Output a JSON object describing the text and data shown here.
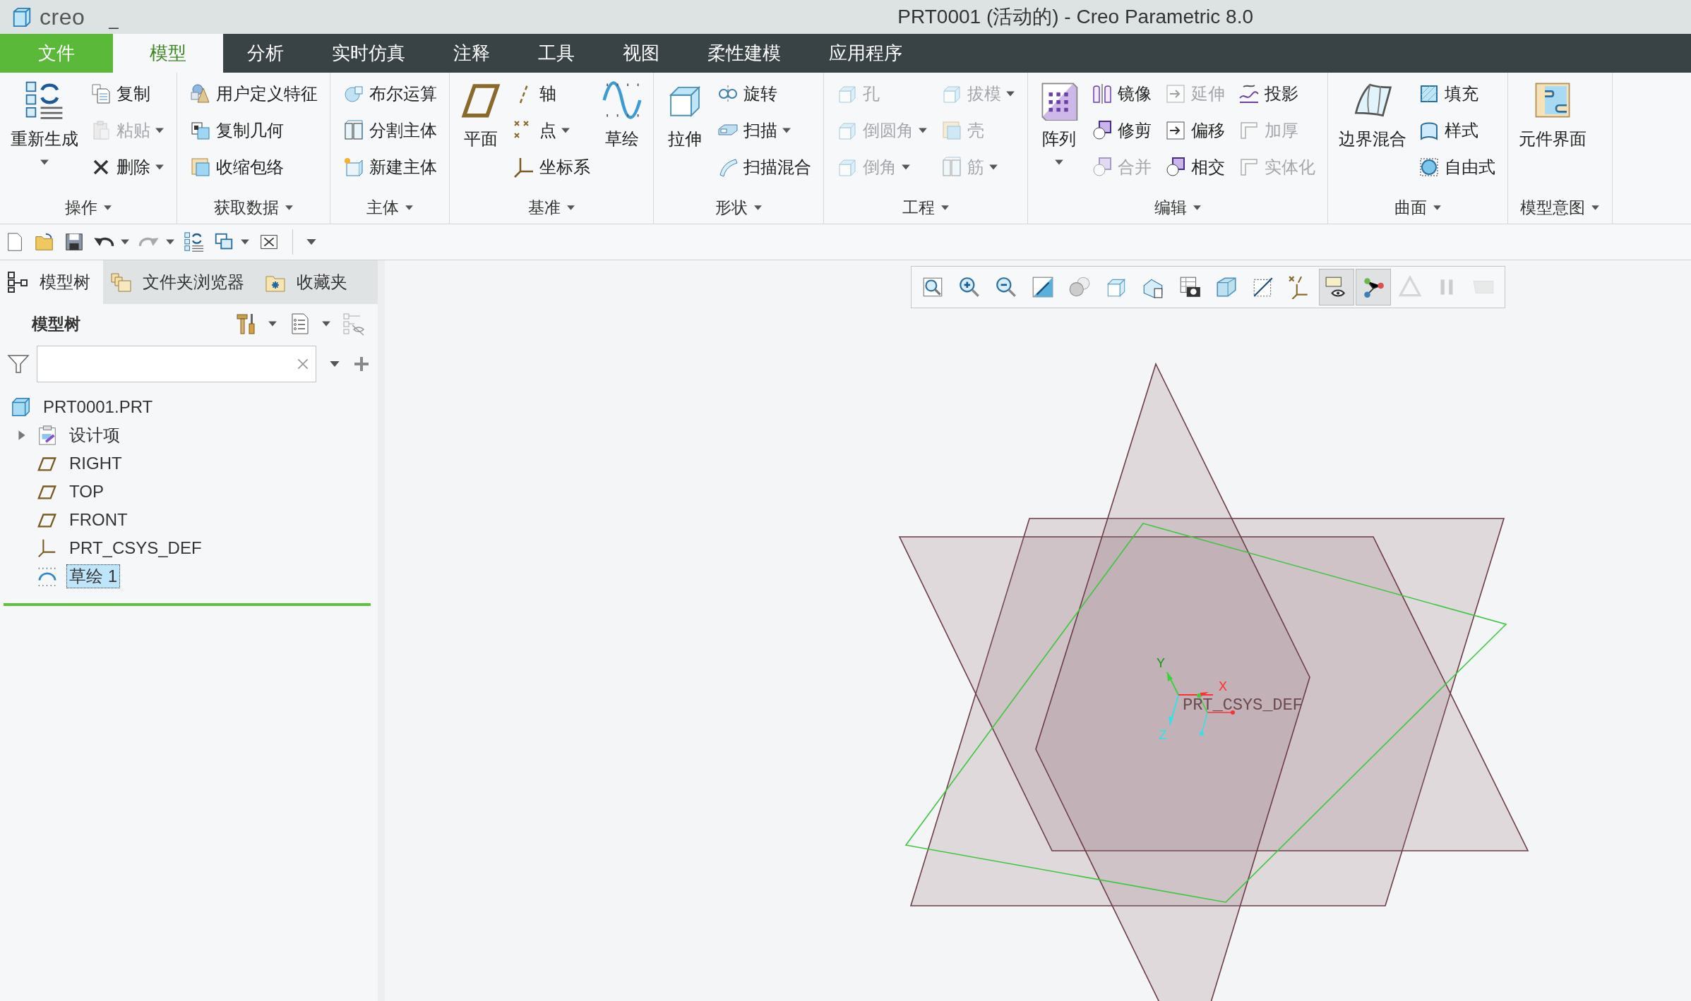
{
  "title_bar": {
    "logo": "creo",
    "minimize": "_",
    "title": "PRT0001 (活动的) - Creo Parametric 8.0"
  },
  "menu_tabs": [
    {
      "label": "文件",
      "kind": "file",
      "selected": false
    },
    {
      "label": "模型",
      "kind": "tab",
      "selected": true
    },
    {
      "label": "分析",
      "kind": "tab",
      "selected": false
    },
    {
      "label": "实时仿真",
      "kind": "tab",
      "selected": false
    },
    {
      "label": "注释",
      "kind": "tab",
      "selected": false
    },
    {
      "label": "工具",
      "kind": "tab",
      "selected": false
    },
    {
      "label": "视图",
      "kind": "tab",
      "selected": false
    },
    {
      "label": "柔性建模",
      "kind": "tab",
      "selected": false
    },
    {
      "label": "应用程序",
      "kind": "tab",
      "selected": false
    }
  ],
  "ribbon": [
    {
      "label": "操作",
      "items": [
        {
          "label": "重新生成",
          "kind": "large",
          "dropdown": true,
          "disabled": false
        },
        {
          "label": "复制",
          "kind": "small",
          "dropdown": false,
          "disabled": false
        },
        {
          "label": "粘贴",
          "kind": "small",
          "dropdown": true,
          "disabled": true
        },
        {
          "label": "删除",
          "kind": "small",
          "dropdown": true,
          "disabled": false
        }
      ]
    },
    {
      "label": "获取数据",
      "items": [
        {
          "label": "用户定义特征",
          "kind": "small",
          "dropdown": false,
          "disabled": false
        },
        {
          "label": "复制几何",
          "kind": "small",
          "dropdown": false,
          "disabled": false
        },
        {
          "label": "收缩包络",
          "kind": "small",
          "dropdown": false,
          "disabled": false
        }
      ]
    },
    {
      "label": "主体",
      "items": [
        {
          "label": "布尔运算",
          "kind": "small",
          "dropdown": false,
          "disabled": false
        },
        {
          "label": "分割主体",
          "kind": "small",
          "dropdown": false,
          "disabled": false
        },
        {
          "label": "新建主体",
          "kind": "small",
          "dropdown": false,
          "disabled": false
        }
      ]
    },
    {
      "label": "基准",
      "items": [
        {
          "label": "平面",
          "kind": "large",
          "dropdown": false,
          "disabled": false
        },
        {
          "label": "轴",
          "kind": "small",
          "dropdown": false,
          "disabled": false
        },
        {
          "label": "点",
          "kind": "small",
          "dropdown": true,
          "disabled": false
        },
        {
          "label": "坐标系",
          "kind": "small",
          "dropdown": false,
          "disabled": false
        },
        {
          "label": "草绘",
          "kind": "large",
          "dropdown": false,
          "disabled": false
        }
      ]
    },
    {
      "label": "形状",
      "items": [
        {
          "label": "拉伸",
          "kind": "large",
          "dropdown": false,
          "disabled": false
        },
        {
          "label": "旋转",
          "kind": "small",
          "dropdown": false,
          "disabled": false
        },
        {
          "label": "扫描",
          "kind": "small",
          "dropdown": true,
          "disabled": false
        },
        {
          "label": "扫描混合",
          "kind": "small",
          "dropdown": false,
          "disabled": false
        }
      ]
    },
    {
      "label": "工程",
      "items": [
        {
          "label": "孔",
          "kind": "small",
          "dropdown": false,
          "disabled": true
        },
        {
          "label": "倒圆角",
          "kind": "small",
          "dropdown": true,
          "disabled": true
        },
        {
          "label": "倒角",
          "kind": "small",
          "dropdown": true,
          "disabled": true
        },
        {
          "label": "拔模",
          "kind": "small",
          "dropdown": true,
          "disabled": true
        },
        {
          "label": "壳",
          "kind": "small",
          "dropdown": false,
          "disabled": true
        },
        {
          "label": "筋",
          "kind": "small",
          "dropdown": true,
          "disabled": true
        }
      ]
    },
    {
      "label": "编辑",
      "items": [
        {
          "label": "阵列",
          "kind": "large",
          "dropdown": true,
          "disabled": false
        },
        {
          "label": "镜像",
          "kind": "small",
          "dropdown": false,
          "disabled": false
        },
        {
          "label": "修剪",
          "kind": "small",
          "dropdown": false,
          "disabled": false
        },
        {
          "label": "合并",
          "kind": "small",
          "dropdown": false,
          "disabled": true
        },
        {
          "label": "延伸",
          "kind": "small",
          "dropdown": false,
          "disabled": true
        },
        {
          "label": "偏移",
          "kind": "small",
          "dropdown": false,
          "disabled": false
        },
        {
          "label": "相交",
          "kind": "small",
          "dropdown": false,
          "disabled": false
        },
        {
          "label": "投影",
          "kind": "small",
          "dropdown": false,
          "disabled": false
        },
        {
          "label": "加厚",
          "kind": "small",
          "dropdown": false,
          "disabled": true
        },
        {
          "label": "实体化",
          "kind": "small",
          "dropdown": false,
          "disabled": true
        }
      ]
    },
    {
      "label": "曲面",
      "items": [
        {
          "label": "边界混合",
          "kind": "large",
          "dropdown": false,
          "disabled": false
        },
        {
          "label": "填充",
          "kind": "small",
          "dropdown": false,
          "disabled": false
        },
        {
          "label": "样式",
          "kind": "small",
          "dropdown": false,
          "disabled": false
        },
        {
          "label": "自由式",
          "kind": "small",
          "dropdown": false,
          "disabled": false
        }
      ]
    },
    {
      "label": "模型意图",
      "items": [
        {
          "label": "元件界面",
          "kind": "large",
          "dropdown": false,
          "disabled": false
        }
      ]
    }
  ],
  "model_tree": {
    "tabs": [
      {
        "label": "模型树",
        "selected": true
      },
      {
        "label": "文件夹浏览器",
        "selected": false
      },
      {
        "label": "收藏夹",
        "selected": false
      }
    ],
    "title": "模型树",
    "items": [
      {
        "label": "PRT0001.PRT",
        "kind": "part",
        "selected": false,
        "children": [
          {
            "label": "设计项",
            "kind": "group",
            "expanded": false,
            "selected": false
          },
          {
            "label": "RIGHT",
            "kind": "plane",
            "selected": false
          },
          {
            "label": "TOP",
            "kind": "plane",
            "selected": false
          },
          {
            "label": "FRONT",
            "kind": "plane",
            "selected": false
          },
          {
            "label": "PRT_CSYS_DEF",
            "kind": "csys",
            "selected": false
          },
          {
            "label": "草绘 1",
            "kind": "sketch",
            "selected": true
          }
        ]
      }
    ]
  },
  "view_toolbar": [
    {
      "on": false,
      "disabled": false
    },
    {
      "on": false,
      "disabled": false
    },
    {
      "on": false,
      "disabled": false
    },
    {
      "on": false,
      "disabled": false
    },
    {
      "on": false,
      "disabled": false
    },
    {
      "on": false,
      "disabled": false
    },
    {
      "on": false,
      "disabled": false
    },
    {
      "on": false,
      "disabled": false
    },
    {
      "on": false,
      "disabled": false
    },
    {
      "on": false,
      "disabled": false
    },
    {
      "on": false,
      "disabled": false
    },
    {
      "on": true,
      "disabled": false
    },
    {
      "on": true,
      "disabled": false
    },
    {
      "on": false,
      "disabled": true
    },
    {
      "on": false,
      "disabled": true
    },
    {
      "on": false,
      "disabled": true
    }
  ],
  "viewport": {
    "csys_label": "PRT_CSYS_DEF",
    "axis_labels": [
      "X",
      "Y",
      "Z"
    ]
  }
}
